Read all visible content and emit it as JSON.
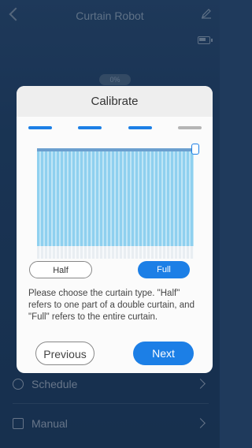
{
  "app": {
    "title": "Curtain Robot",
    "position_percent_label": "0%"
  },
  "bottom_menu": [
    {
      "label": "Schedule",
      "icon": "clock-icon"
    },
    {
      "label": "Manual",
      "icon": "document-icon"
    }
  ],
  "modal": {
    "title": "Calibrate",
    "steps_total": 4,
    "steps_completed": 3,
    "curtain_type_options": [
      "Half",
      "Full"
    ],
    "selected_type": "Full",
    "description": "Please choose the curtain type. \"Half\" refers to one part of a double curtain, and \"Full\" refers to the entire curtain.",
    "previous_label": "Previous",
    "next_label": "Next",
    "accent_color": "#1c7fe6"
  }
}
